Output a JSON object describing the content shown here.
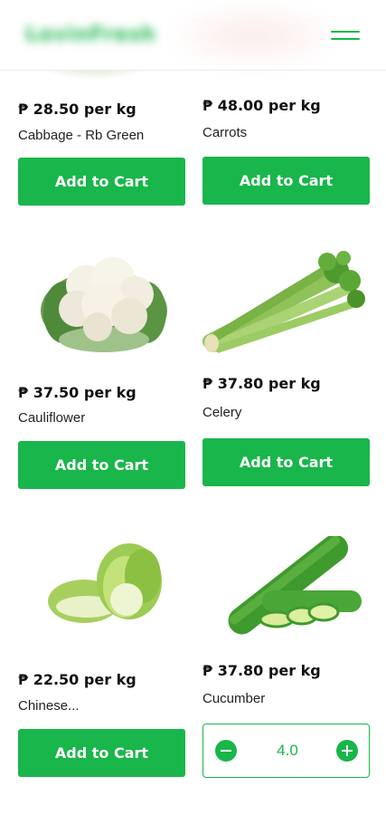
{
  "header": {
    "logo_text": "LovinFresh",
    "menu_icon": "hamburger-icon"
  },
  "currency_symbol": "₱",
  "products": [
    {
      "price": "₱ 28.50 per kg",
      "name": "Cabbage - Rb Green",
      "button": "Add to Cart"
    },
    {
      "price": "₱ 48.00 per kg",
      "name": "Carrots",
      "button": "Add to Cart"
    },
    {
      "price": "₱ 37.50 per kg",
      "name": "Cauliflower",
      "button": "Add to Cart"
    },
    {
      "price": "₱ 37.80 per kg",
      "name": "Celery",
      "button": "Add to Cart"
    },
    {
      "price": "₱ 22.50 per kg",
      "name": "Chinese...",
      "button": "Add to Cart"
    },
    {
      "price": "₱ 37.80 per kg",
      "name": "Cucumber",
      "quantity": "4.0"
    }
  ],
  "colors": {
    "accent": "#19b64b",
    "text": "#111111"
  }
}
